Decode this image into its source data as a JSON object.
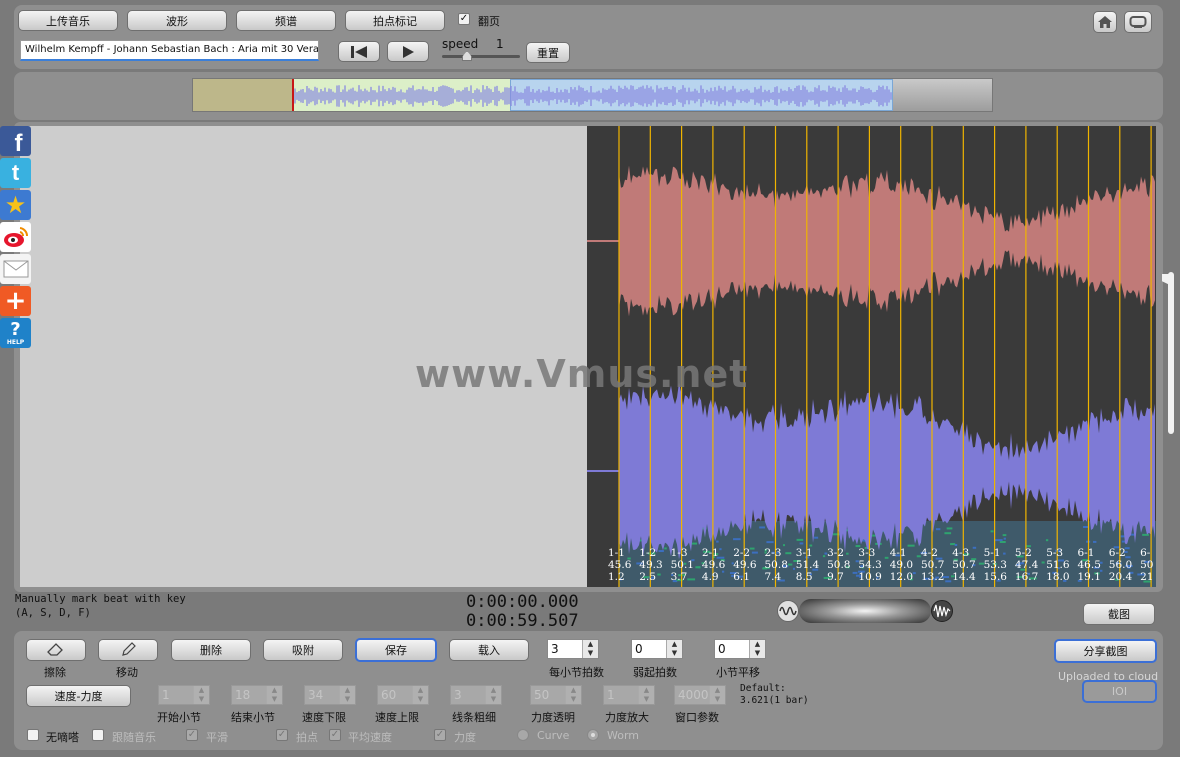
{
  "toolbar": {
    "upload_label": "上传音乐",
    "waveform_label": "波形",
    "spectrum_label": "频谱",
    "beat_mark_label": "拍点标记",
    "page_turn_label": "翻页",
    "page_turn_checked": true,
    "track_title": "Wilhelm Kempff - Johann Sebastian Bach :  Aria mit 30 Vera",
    "speed_label": "speed",
    "speed_value": "1",
    "reset_label": "重置"
  },
  "social": {
    "icons": [
      "facebook-icon",
      "twitter-icon",
      "favorite-star-icon",
      "weibo-icon",
      "mail-icon",
      "add-icon",
      "help-icon"
    ],
    "help_text": "HELP"
  },
  "watermark": "www.Vmus.net",
  "beats": [
    {
      "bar": "1-1",
      "bpm": "45.6",
      "time": "1.2"
    },
    {
      "bar": "1-2",
      "bpm": "49.3",
      "time": "2.5"
    },
    {
      "bar": "1-3",
      "bpm": "50.1",
      "time": "3.7"
    },
    {
      "bar": "2-1",
      "bpm": "49.6",
      "time": "4.9"
    },
    {
      "bar": "2-2",
      "bpm": "49.6",
      "time": "6.1"
    },
    {
      "bar": "2-3",
      "bpm": "50.8",
      "time": "7.4"
    },
    {
      "bar": "3-1",
      "bpm": "51.4",
      "time": "8.5"
    },
    {
      "bar": "3-2",
      "bpm": "50.8",
      "time": "9.7"
    },
    {
      "bar": "3-3",
      "bpm": "54.3",
      "time": "10.9"
    },
    {
      "bar": "4-1",
      "bpm": "49.0",
      "time": "12.0"
    },
    {
      "bar": "4-2",
      "bpm": "50.7",
      "time": "13.2"
    },
    {
      "bar": "4-3",
      "bpm": "50.7",
      "time": "14.4"
    },
    {
      "bar": "5-1",
      "bpm": "53.3",
      "time": "15.6"
    },
    {
      "bar": "5-2",
      "bpm": "47.4",
      "time": "16.7"
    },
    {
      "bar": "5-3",
      "bpm": "51.6",
      "time": "18.0"
    },
    {
      "bar": "6-1",
      "bpm": "46.5",
      "time": "19.1"
    },
    {
      "bar": "6-2",
      "bpm": "56.0",
      "time": "20.4"
    },
    {
      "bar": "6-",
      "bpm": "50",
      "time": "21"
    }
  ],
  "status": {
    "hint_line1": "Manually mark beat with key",
    "hint_line2": "(A, S, D, F)",
    "time_current": "0:00:00.000",
    "time_total": "0:00:59.507",
    "screenshot_label": "截图"
  },
  "controls": {
    "erase_label": "擦除",
    "move_label": "移动",
    "delete_label": "删除",
    "snap_label": "吸附",
    "save_label": "保存",
    "load_label": "载入",
    "beats_per_bar_value": "3",
    "beats_per_bar_label": "每小节拍数",
    "pickup_value": "0",
    "pickup_label": "弱起拍数",
    "shift_value": "0",
    "shift_label": "小节平移",
    "share_label": "分享截图",
    "uploaded_label": "Uploaded to cloud",
    "io_label": "IOI",
    "tempo_dynamics_label": "速度-力度",
    "start_bar_label": "开始小节",
    "end_bar_label": "结束小节",
    "tempo_min_label": "速度下限",
    "tempo_max_label": "速度上限",
    "line_width_label": "线条粗细",
    "dyn_alpha_label": "力度透明",
    "dyn_zoom_label": "力度放大",
    "window_label": "窗口参数",
    "start_bar_value": "1",
    "end_bar_value": "18",
    "tempo_min_value": "34",
    "tempo_max_value": "60",
    "line_width_value": "3",
    "dyn_alpha_value": "50",
    "dyn_zoom_value": "1",
    "window_value": "4000",
    "default_line1": "Default:",
    "default_line2": "3.621(1 bar)",
    "no_drip_label": "无嘀嗒",
    "follow_music_label": "跟随音乐",
    "smooth_label": "平滑",
    "beat_label": "拍点",
    "avg_speed_label": "平均速度",
    "dynamics_label": "力度",
    "curve_label": "Curve",
    "worm_label": "Worm"
  },
  "colors": {
    "beat_line": "#f0b400",
    "wave_upper": "#c07a78",
    "wave_lower": "#7e7ad6",
    "spectrum_bg": "#3a3a3a"
  }
}
